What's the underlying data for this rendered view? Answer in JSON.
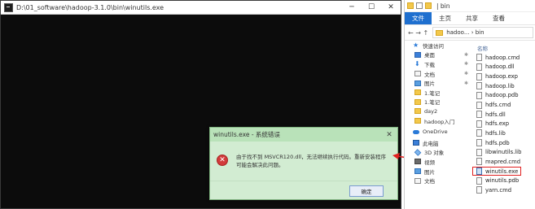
{
  "console": {
    "title": "D:\\01_software\\hadoop-3.1.0\\bin\\winutils.exe",
    "minimize": "─",
    "maximize": "☐",
    "close": "✕"
  },
  "dialog": {
    "title": "winutils.exe - 系统错误",
    "close": "✕",
    "icon": "✕",
    "message": "由于找不到 MSVCR120.dll，无法继续执行代码。重新安装程序可能会解决此问题。",
    "ok_label": "确定"
  },
  "explorer": {
    "title_path": "| bin",
    "ribbon": [
      "文件",
      "主页",
      "共享",
      "查看"
    ],
    "addr_nav": "←  →  ↑",
    "addr_path": "hadoo... › bin",
    "column_header": "名称",
    "nav_items": [
      {
        "label": "快速访问",
        "icon": "star-icon",
        "head": true,
        "pin": false
      },
      {
        "label": "桌面",
        "icon": "desktop-icon",
        "head": false,
        "pin": true
      },
      {
        "label": "下载",
        "icon": "download-icon",
        "head": false,
        "pin": true
      },
      {
        "label": "文档",
        "icon": "documents-icon",
        "head": false,
        "pin": true
      },
      {
        "label": "图片",
        "icon": "pictures-icon",
        "head": false,
        "pin": true
      },
      {
        "label": "1.笔记",
        "icon": "folder-icon",
        "head": false,
        "pin": false
      },
      {
        "label": "1.笔记",
        "icon": "folder-icon",
        "head": false,
        "pin": false
      },
      {
        "label": "day2",
        "icon": "folder-icon",
        "head": false,
        "pin": false
      },
      {
        "label": "hadoop入门",
        "icon": "folder-icon",
        "head": false,
        "pin": false
      },
      {
        "label": "OneDrive",
        "icon": "onedrive-icon",
        "head": true,
        "pin": false
      },
      {
        "label": "此电脑",
        "icon": "this-pc-icon",
        "head": true,
        "pin": false
      },
      {
        "label": "3D 对象",
        "icon": "3d-objects-icon",
        "head": false,
        "pin": false
      },
      {
        "label": "视频",
        "icon": "videos-icon",
        "head": false,
        "pin": false
      },
      {
        "label": "图片",
        "icon": "pictures-icon",
        "head": false,
        "pin": false
      },
      {
        "label": "文档",
        "icon": "documents-icon",
        "head": false,
        "pin": false
      }
    ],
    "files": [
      {
        "name": "hadoop.cmd",
        "type": "file"
      },
      {
        "name": "hadoop.dll",
        "type": "file"
      },
      {
        "name": "hadoop.exp",
        "type": "file"
      },
      {
        "name": "hadoop.lib",
        "type": "file"
      },
      {
        "name": "hadoop.pdb",
        "type": "file"
      },
      {
        "name": "hdfs.cmd",
        "type": "file"
      },
      {
        "name": "hdfs.dll",
        "type": "file"
      },
      {
        "name": "hdfs.exp",
        "type": "file"
      },
      {
        "name": "hdfs.lib",
        "type": "file"
      },
      {
        "name": "hdfs.pdb",
        "type": "file"
      },
      {
        "name": "libwinutils.lib",
        "type": "file"
      },
      {
        "name": "mapred.cmd",
        "type": "file"
      },
      {
        "name": "winutils.exe",
        "type": "exe",
        "highlight": true
      },
      {
        "name": "winutils.pdb",
        "type": "file"
      },
      {
        "name": "yarn.cmd",
        "type": "file"
      }
    ]
  },
  "colors": {
    "dialog_title_bg": "#b9e2b9",
    "dialog_body_bg": "#d2ecd2",
    "ribbon_active": "#1e6fcf",
    "highlight_outline": "#e02020",
    "arrow": "#e02020"
  }
}
